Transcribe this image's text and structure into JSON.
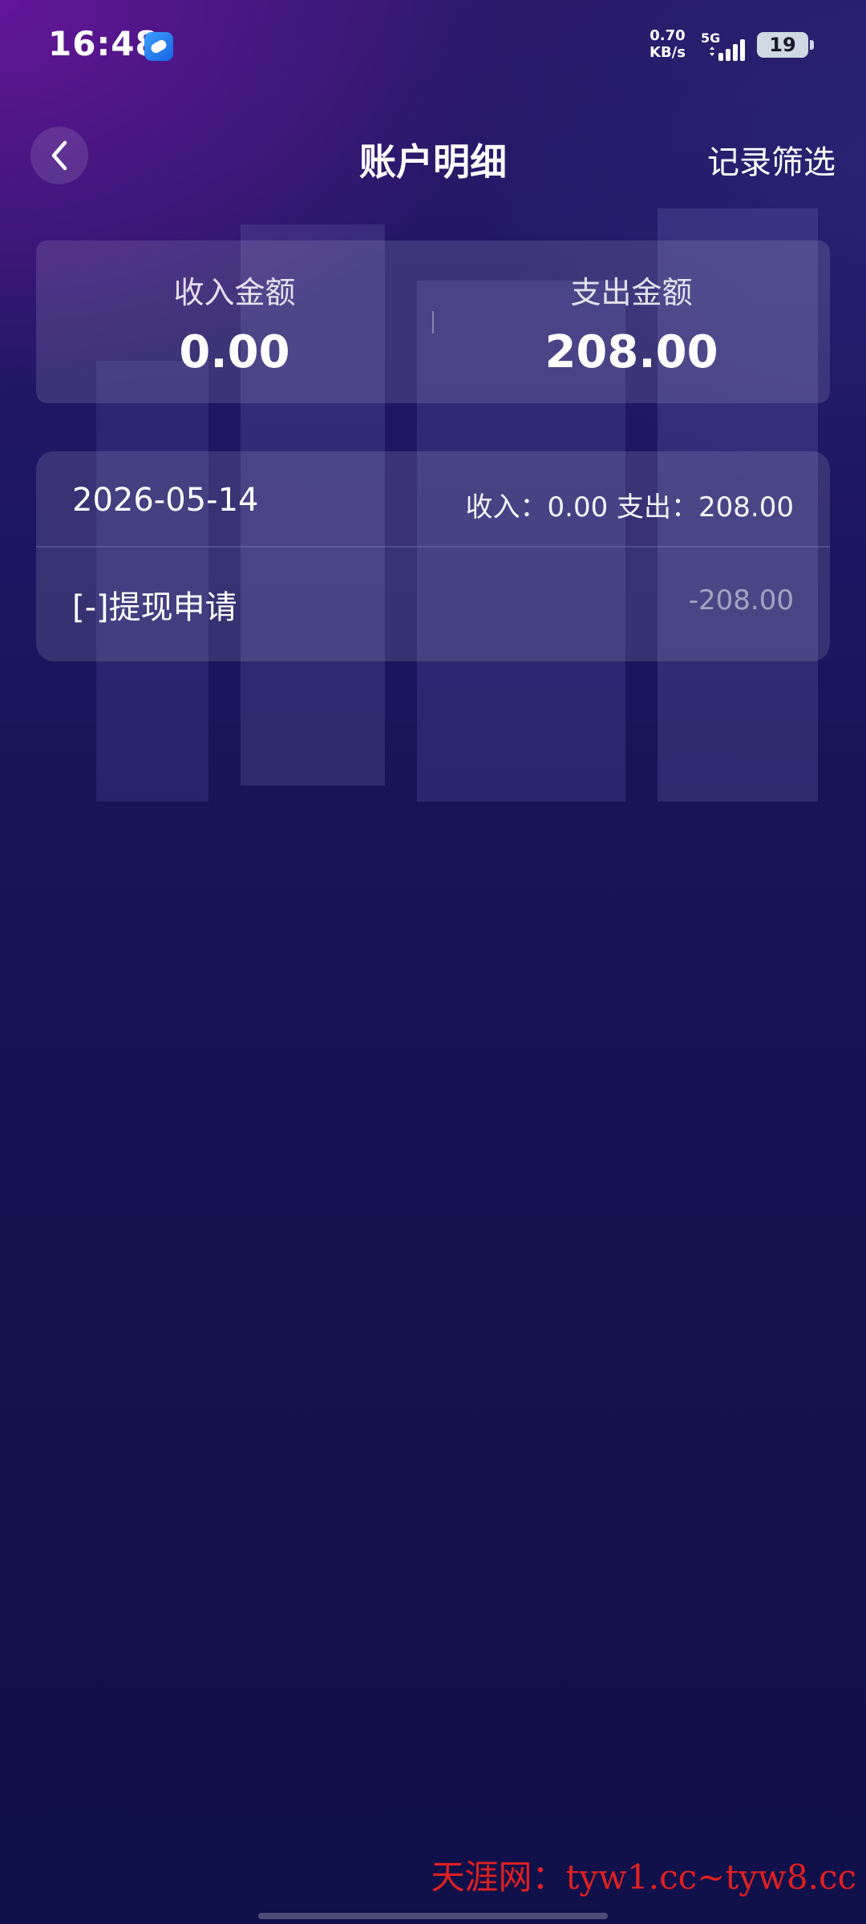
{
  "status_bar": {
    "time": "16:48",
    "net_speed_value": "0.70",
    "net_speed_unit": "KB/s",
    "network_type": "5G",
    "battery": "19"
  },
  "nav": {
    "title": "账户明细",
    "filter_label": "记录筛选"
  },
  "summary": {
    "income_label": "收入金额",
    "income_value": "0.00",
    "expense_label": "支出金额",
    "expense_value": "208.00"
  },
  "records": [
    {
      "date": "2026-05-14",
      "totals": "收入：0.00 支出：208.00",
      "items": [
        {
          "title": "[-]提现申请",
          "amount": "-208.00"
        }
      ]
    }
  ],
  "watermark": {
    "brand": "天涯网：",
    "urls": "tyw1.cc~tyw8.cc"
  },
  "colors": {
    "background_top": "#2a1a6a",
    "background_bottom": "#10104a",
    "watermark": "#e02020"
  }
}
